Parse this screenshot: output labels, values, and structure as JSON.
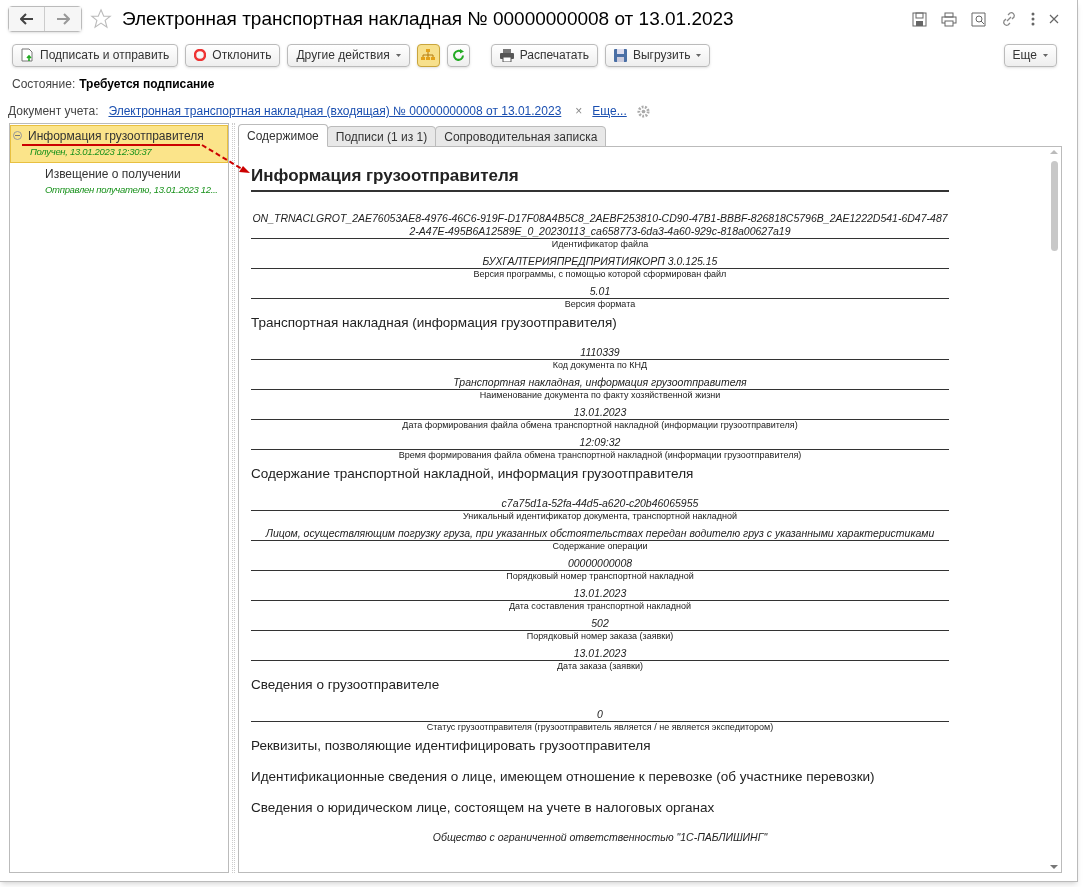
{
  "window": {
    "title": "Электронная транспортная накладная № 00000000008 от 13.01.2023"
  },
  "toolbar": [
    {
      "kind": "sign",
      "label": "Подписать и отправить",
      "dropdown": false,
      "pressed": false
    },
    {
      "kind": "reject",
      "label": "Отклонить",
      "dropdown": false,
      "pressed": false
    },
    {
      "kind": "menu",
      "label": "Другие действия",
      "dropdown": true,
      "pressed": false
    },
    {
      "kind": "tree",
      "dropdown": false,
      "pressed": true
    },
    {
      "kind": "refresh",
      "dropdown": false,
      "pressed": false
    },
    {
      "kind": "print",
      "label": "Распечатать",
      "dropdown": false,
      "pressed": false
    },
    {
      "kind": "export",
      "label": "Выгрузить",
      "dropdown": true,
      "pressed": false
    }
  ],
  "more_button": {
    "label": "Еще"
  },
  "state": {
    "label": "Состояние:",
    "value": "Требуется подписание"
  },
  "document": {
    "label": "Документ учета:",
    "link": "Электронная транспортная накладная (входящая) № 00000000008 от 13.01.2023",
    "clear": "×",
    "more": "Еще..."
  },
  "tree": [
    {
      "label": "Информация грузоотправителя",
      "status": "Получен, 13.01.2023 12:30:37",
      "selected": true,
      "expanded": true,
      "children": [
        {
          "label": "Извещение о получении",
          "status": "Отправлен получателю, 13.01.2023 12...",
          "selected": false
        }
      ]
    }
  ],
  "tabs": [
    {
      "label": "Содержимое",
      "selected": true
    },
    {
      "label": "Подписи (1 из 1)",
      "selected": false
    },
    {
      "label": "Сопроводительная записка",
      "selected": false
    }
  ],
  "content": {
    "heading": "Информация грузоотправителя",
    "items": [
      {
        "kind": "field",
        "value": "ON_TRNACLGROT_2AE76053AE8-4976-46C6-919F-D17F08A4B5C8_2AEBF253810-CD90-47B1-BBBF-826818C5796B_2AE1222D541-6D47-4872-A47E-495B6A12589E_0_20230113_ca658773-6da3-4a60-929c-818a00627a19",
        "label": "Идентификатор файла"
      },
      {
        "kind": "field",
        "value": "БУХГАЛТЕРИЯПРЕДПРИЯТИЯКОРП 3.0.125.15",
        "label": "Версия программы, с помощью которой сформирован файл"
      },
      {
        "kind": "field",
        "value": "5.01",
        "label": "Версия формата"
      },
      {
        "kind": "section",
        "text": "Транспортная накладная (информация грузоотправителя)"
      },
      {
        "kind": "field",
        "value": "1110339",
        "label": "Код документа по КНД"
      },
      {
        "kind": "field",
        "value": "Транспортная накладная, информация грузоотправителя",
        "label": "Наименование документа по факту хозяйственной жизни"
      },
      {
        "kind": "field",
        "value": "13.01.2023",
        "label": "Дата формирования файла обмена транспортной накладной (информации грузоотправителя)"
      },
      {
        "kind": "field",
        "value": "12:09:32",
        "label": "Время формирования файла обмена транспортной накладной (информации грузоотправителя)"
      },
      {
        "kind": "section",
        "text": "Содержание транспортной накладной, информация грузоотправителя"
      },
      {
        "kind": "field",
        "value": "c7a75d1a-52fa-44d5-a620-c20b46065955",
        "label": "Уникальный идентификатор документа, транспортной накладной"
      },
      {
        "kind": "field",
        "value": "Лицом, осуществляющим погрузку груза, при указанных обстоятельствах передан водителю груз с указанными характеристиками",
        "label": "Содержание операции"
      },
      {
        "kind": "field",
        "value": "00000000008",
        "label": "Порядковый номер транспортной накладной"
      },
      {
        "kind": "field",
        "value": "13.01.2023",
        "label": "Дата составления транспортной накладной"
      },
      {
        "kind": "field",
        "value": "502",
        "label": "Порядковый номер заказа (заявки)"
      },
      {
        "kind": "field",
        "value": "13.01.2023",
        "label": "Дата заказа (заявки)"
      },
      {
        "kind": "section",
        "text": "Сведения о грузоотправителе"
      },
      {
        "kind": "field",
        "value": "0",
        "label": "Статус грузоотправителя (грузоотправитель является / не является экспедитором)"
      },
      {
        "kind": "section",
        "text": "Реквизиты, позволяющие идентифицировать грузоотправителя"
      },
      {
        "kind": "section",
        "text": "Идентификационные сведения о лице, имеющем отношение к перевозке (об участнике перевозки)"
      },
      {
        "kind": "section",
        "text": "Сведения о юридическом лице, состоящем на учете в налоговых органах"
      },
      {
        "kind": "field",
        "value": "Общество с ограниченной ответственностью \"1С-ПАБЛИШИНГ\""
      }
    ]
  }
}
